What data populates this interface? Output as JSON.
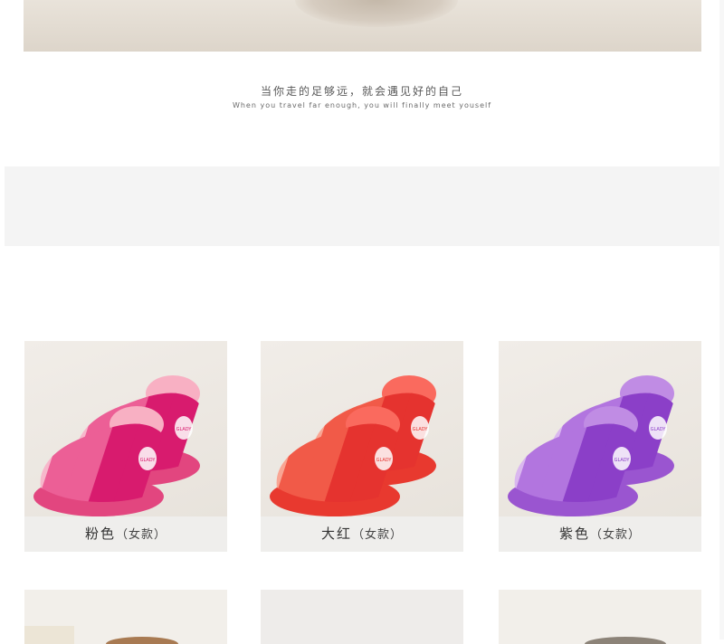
{
  "slogan": {
    "chinese": "当你走的足够远，就会遇见好的自己",
    "english": "When you travel far enough, you will finally meet youself"
  },
  "products": [
    {
      "color_name": "粉色",
      "style": "（女款）",
      "icon": "slipper-pink",
      "colors": {
        "dark": "#d81b6e",
        "mid": "#ec5f96",
        "light": "#f7b7cb",
        "pale": "#fae0e6",
        "fur": "#f8b0c3",
        "sole": "#e2467f"
      }
    },
    {
      "color_name": "大红",
      "style": "（女款）",
      "icon": "slipper-red",
      "colors": {
        "dark": "#e5332f",
        "mid": "#f15a48",
        "light": "#f9a593",
        "pale": "#fbd9cf",
        "fur": "#fa6a5e",
        "sole": "#e8392f"
      }
    },
    {
      "color_name": "紫色",
      "style": "（女款）",
      "icon": "slipper-purple",
      "colors": {
        "dark": "#8b3fc8",
        "mid": "#b275df",
        "light": "#dab7ef",
        "pale": "#f1e1f6",
        "fur": "#c08ce4",
        "sole": "#9a55d0"
      }
    }
  ],
  "badge_text": "GLADY"
}
